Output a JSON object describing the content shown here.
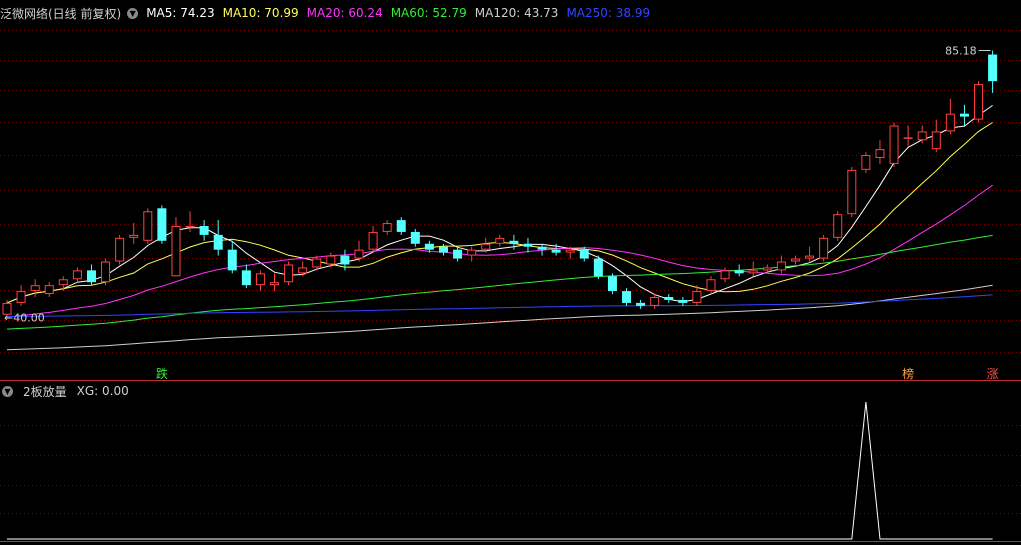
{
  "header": {
    "title": "泛微网络(日线 前复权)",
    "ma": [
      {
        "label": "MA5: 74.23",
        "color": "#ffffff"
      },
      {
        "label": "MA10: 70.99",
        "color": "#ffff55"
      },
      {
        "label": "MA20: 60.24",
        "color": "#ff33ff"
      },
      {
        "label": "MA60: 52.79",
        "color": "#33ee33"
      },
      {
        "label": "MA120: 43.73",
        "color": "#cfcfcf"
      },
      {
        "label": "MA250: 38.99",
        "color": "#3344ff"
      }
    ]
  },
  "indicator_header": {
    "name": "2板放量",
    "value": "XG: 0.00"
  },
  "colors": {
    "up": "#ff4040",
    "down": "#54ffff",
    "grid": "#7a0000",
    "separator": "#c03030"
  },
  "chart_data": [
    {
      "type": "candlestick",
      "title": "泛微网络(日线 前复权)",
      "ylim": [
        32,
        90
      ],
      "high_label": "85.18",
      "low_label": "40.00",
      "markers": [
        {
          "index": 11,
          "text": "跌",
          "color": "#33ee33"
        },
        {
          "index": 64,
          "text": "榜",
          "color": "#ffa040"
        },
        {
          "index": 70,
          "text": "涨",
          "color": "#ff5050"
        }
      ],
      "candles": [
        [
          40.5,
          42.5,
          40.0,
          43.0
        ],
        [
          42.5,
          44.5,
          42.0,
          45.5
        ],
        [
          44.5,
          45.5,
          43.5,
          46.5
        ],
        [
          44.0,
          45.5,
          43.5,
          46.0
        ],
        [
          45.5,
          46.5,
          44.5,
          47.0
        ],
        [
          46.5,
          48.0,
          46.0,
          48.5
        ],
        [
          48.0,
          46.0,
          45.5,
          49.0
        ],
        [
          46.0,
          49.5,
          45.5,
          50.0
        ],
        [
          49.5,
          53.5,
          49.0,
          54.0
        ],
        [
          53.5,
          54.0,
          52.5,
          56.0
        ],
        [
          53.0,
          58.0,
          52.5,
          58.5
        ],
        [
          58.5,
          53.0,
          52.5,
          59.0
        ],
        [
          47.0,
          55.5,
          47.0,
          57.0
        ],
        [
          55.5,
          55.5,
          54.5,
          58.0
        ],
        [
          55.5,
          54.0,
          53.0,
          56.5
        ],
        [
          54.0,
          51.5,
          50.5,
          56.5
        ],
        [
          51.5,
          48.0,
          47.5,
          53.0
        ],
        [
          48.0,
          45.5,
          45.0,
          49.0
        ],
        [
          45.5,
          47.5,
          44.5,
          48.0
        ],
        [
          45.5,
          46.0,
          44.5,
          47.5
        ],
        [
          46.0,
          49.0,
          45.5,
          49.5
        ],
        [
          47.5,
          48.5,
          47.0,
          49.5
        ],
        [
          48.5,
          50.0,
          48.0,
          50.5
        ],
        [
          49.0,
          50.5,
          48.5,
          51.0
        ],
        [
          50.5,
          49.0,
          48.0,
          51.5
        ],
        [
          50.0,
          51.5,
          49.5,
          53.0
        ],
        [
          51.5,
          54.5,
          51.0,
          55.5
        ],
        [
          54.5,
          56.0,
          54.0,
          56.5
        ],
        [
          56.5,
          54.5,
          54.0,
          57.0
        ],
        [
          54.5,
          52.5,
          52.0,
          55.0
        ],
        [
          52.5,
          51.5,
          51.0,
          53.0
        ],
        [
          52.0,
          51.0,
          50.5,
          52.5
        ],
        [
          51.5,
          50.0,
          49.5,
          52.0
        ],
        [
          50.5,
          51.5,
          49.5,
          52.0
        ],
        [
          51.5,
          52.5,
          51.0,
          53.5
        ],
        [
          52.5,
          53.5,
          52.0,
          54.0
        ],
        [
          53.0,
          52.5,
          51.5,
          54.0
        ],
        [
          52.5,
          52.0,
          51.0,
          53.5
        ],
        [
          52.0,
          51.5,
          50.5,
          52.5
        ],
        [
          51.5,
          51.0,
          50.5,
          52.5
        ],
        [
          51.0,
          51.5,
          50.0,
          52.0
        ],
        [
          51.5,
          50.0,
          49.5,
          52.0
        ],
        [
          50.0,
          47.0,
          46.5,
          50.5
        ],
        [
          47.0,
          44.5,
          44.0,
          47.5
        ],
        [
          44.5,
          42.5,
          42.0,
          45.0
        ],
        [
          42.5,
          42.0,
          41.5,
          43.0
        ],
        [
          42.0,
          43.5,
          41.5,
          44.0
        ],
        [
          43.5,
          43.0,
          42.5,
          44.0
        ],
        [
          43.0,
          42.5,
          42.0,
          43.5
        ],
        [
          42.5,
          44.5,
          42.0,
          45.5
        ],
        [
          44.5,
          46.5,
          44.0,
          47.0
        ],
        [
          46.5,
          48.0,
          46.0,
          48.5
        ],
        [
          48.0,
          47.5,
          47.0,
          49.0
        ],
        [
          47.5,
          48.0,
          47.0,
          49.5
        ],
        [
          48.0,
          48.5,
          47.5,
          49.0
        ],
        [
          48.0,
          49.5,
          47.5,
          50.5
        ],
        [
          49.5,
          50.0,
          49.0,
          50.5
        ],
        [
          50.0,
          50.5,
          49.5,
          52.0
        ],
        [
          50.0,
          53.5,
          49.5,
          54.0
        ],
        [
          53.5,
          57.5,
          53.0,
          58.0
        ],
        [
          57.5,
          65.0,
          57.0,
          65.5
        ],
        [
          65.0,
          67.5,
          64.5,
          68.0
        ],
        [
          67.0,
          68.5,
          66.0,
          70.0
        ],
        [
          66.0,
          72.5,
          65.5,
          73.0
        ],
        [
          70.5,
          70.5,
          69.0,
          72.5
        ],
        [
          70.0,
          71.5,
          69.5,
          72.5
        ],
        [
          68.5,
          71.5,
          68.0,
          73.5
        ],
        [
          71.5,
          74.5,
          71.0,
          77.0
        ],
        [
          74.5,
          74.0,
          72.5,
          76.0
        ],
        [
          73.5,
          79.5,
          73.0,
          80.0
        ],
        [
          84.5,
          80.0,
          78.0,
          85.18
        ]
      ]
    },
    {
      "type": "line",
      "title": "2板放量",
      "ylim": [
        0,
        1
      ],
      "series": [
        {
          "values": [
            0,
            0,
            0,
            0,
            0,
            0,
            0,
            0,
            0,
            0,
            0,
            0,
            0,
            0,
            0,
            0,
            0,
            0,
            0,
            0,
            0,
            0,
            0,
            0,
            0,
            0,
            0,
            0,
            0,
            0,
            0,
            0,
            0,
            0,
            0,
            0,
            0,
            0,
            0,
            0,
            0,
            0,
            0,
            0,
            0,
            0,
            0,
            0,
            0,
            0,
            0,
            0,
            0,
            0,
            0,
            0,
            0,
            0,
            0,
            0,
            0,
            1,
            0,
            0,
            0,
            0,
            0,
            0,
            0,
            0,
            0
          ]
        }
      ]
    }
  ]
}
